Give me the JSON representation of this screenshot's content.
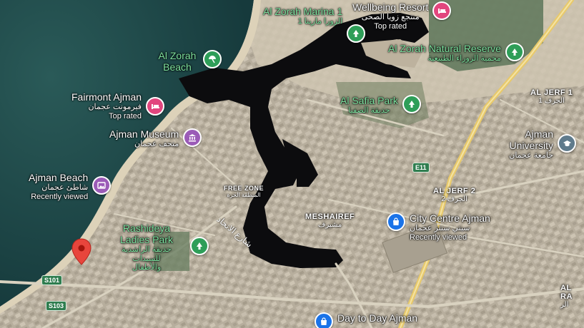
{
  "map": {
    "colors": {
      "sea": "#1f4a4a",
      "land": "#bcb3a3",
      "water_inlet": "#0c0c0e",
      "road": "#d9d2c0",
      "highway": "#e8c96a",
      "accent_green": "#2e9e58"
    },
    "pois": [
      {
        "name": "Al Zorah Marina 1",
        "ar": "الزورا مارينا 1",
        "icon": "tree-icon",
        "pin": "green"
      },
      {
        "name": "Wellbeing Resort",
        "ar": "منتجع زويا الصحى",
        "sub": "Top rated",
        "icon": "bed-icon",
        "pin": "pink"
      },
      {
        "name": "Al Zorah Natural Reserve",
        "ar": "محمية الزوراء الطبيعية",
        "icon": "tree-icon",
        "pin": "green"
      },
      {
        "name": "Al Zorah Beach",
        "icon": "beach-umbrella-icon",
        "pin": "green"
      },
      {
        "name": "Fairmont Ajman",
        "ar": "فيرمونت عجمان",
        "sub": "Top rated",
        "icon": "bed-icon",
        "pin": "pink"
      },
      {
        "name": "Al Safia Park",
        "ar": "حديقة الصفيا",
        "icon": "tree-icon",
        "pin": "green"
      },
      {
        "name": "Ajman Museum",
        "ar": "متحف عجمان",
        "icon": "museum-icon",
        "pin": "purple"
      },
      {
        "name": "Ajman University",
        "ar": "جامعة عجمان",
        "icon": "graduation-cap-icon",
        "pin": "gray"
      },
      {
        "name": "Ajman Beach",
        "ar": "شاطئ عجمان",
        "sub": "Recently viewed",
        "icon": "photo-icon",
        "pin": "purple"
      },
      {
        "name": "City Centre Ajman",
        "ar": "سيتي سنتر عجمان",
        "sub": "Recently viewed",
        "icon": "shopping-bag-icon",
        "pin": "blue"
      },
      {
        "name": "Rashideya Ladies Park",
        "ar": "حديقة الراشدية للسيدات والأطفال",
        "icon": "tree-icon",
        "pin": "green"
      },
      {
        "name": "Day to Day Ajman",
        "icon": "shopping-bag-icon",
        "pin": "blue"
      }
    ],
    "areas": {
      "al_jerf_1": {
        "name": "AL JERF 1",
        "ar": "الجرف 1"
      },
      "al_jerf_2": {
        "name": "AL JERF 2",
        "ar": "الجرف 2"
      },
      "free_zone": {
        "name": "FREE ZONE",
        "ar": "المنطقة الحرة"
      },
      "meshaireff": {
        "name": "MESHAIREF",
        "ar": "مشيرف"
      },
      "al_ra": {
        "name": "AL RA",
        "ar": "الر"
      }
    },
    "road_shields": {
      "e11": "E11",
      "s101": "S101",
      "s103": "S103"
    },
    "street_label": "شارع الاتحاد"
  }
}
